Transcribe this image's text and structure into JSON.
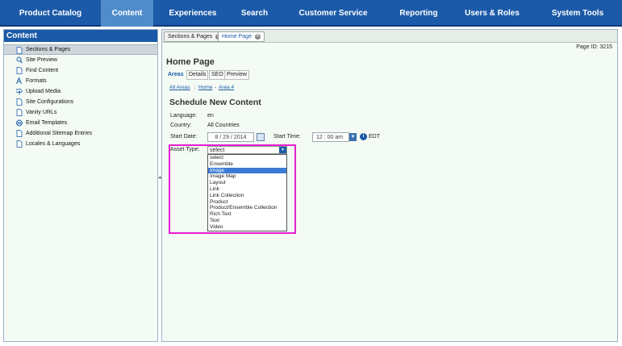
{
  "topnav": [
    {
      "label": "Product Catalog",
      "active": false
    },
    {
      "label": "Content",
      "active": true
    },
    {
      "label": "Experiences",
      "active": false
    },
    {
      "label": "Search",
      "active": false
    },
    {
      "label": "Customer Service",
      "active": false
    },
    {
      "label": "Reporting",
      "active": false
    },
    {
      "label": "Users & Roles",
      "active": false
    },
    {
      "label": "System Tools",
      "active": false
    }
  ],
  "sidebar": {
    "title": "Content",
    "items": [
      {
        "label": "Sections & Pages",
        "icon": "page-icon"
      },
      {
        "label": "Site Preview",
        "icon": "magnifier-icon"
      },
      {
        "label": "Find Content",
        "icon": "page-icon"
      },
      {
        "label": "Formats",
        "icon": "format-icon"
      },
      {
        "label": "Upload Media",
        "icon": "upload-icon"
      },
      {
        "label": "Site Configurations",
        "icon": "page-icon"
      },
      {
        "label": "Vanity URLs",
        "icon": "page-icon"
      },
      {
        "label": "Email Templates",
        "icon": "email-icon"
      },
      {
        "label": "Additional Sitemap Entries",
        "icon": "page-icon"
      },
      {
        "label": "Locales & Languages",
        "icon": "page-icon"
      }
    ]
  },
  "tabs": [
    {
      "label": "Sections & Pages"
    },
    {
      "label": "Home Page"
    }
  ],
  "page_id": "Page ID: 3215",
  "page_title": "Home Page",
  "subtabs": [
    "Areas",
    "Details",
    "SEO",
    "Preview"
  ],
  "breadcrumb": {
    "link1": "All Areas",
    "sep1": ":",
    "link2": "Home",
    "sep2": "-",
    "link3": "Area 4"
  },
  "form": {
    "heading": "Schedule New Content",
    "language_label": "Language:",
    "language_value": "en",
    "country_label": "Country:",
    "country_value": "All Countries",
    "start_date_label": "Start Date:",
    "start_date_value": "8  /  29  /  2014",
    "start_time_label": "Start Time:",
    "start_time_value": "12  :  00    am",
    "timezone": "EDT",
    "asset_type_label": "Asset Type:",
    "asset_type_value": "select",
    "asset_options": [
      "select",
      "Ensemble",
      "Image",
      "Image Map",
      "Layout",
      "Link",
      "Link Collection",
      "Product",
      "Product/Ensemble Collection",
      "Rich Text",
      "Text",
      "Video"
    ],
    "highlighted_option": "Image"
  },
  "colors": {
    "nav_bg": "#1b5aa8",
    "nav_active": "#4f8cc9",
    "highlight_border": "#e61ed2",
    "panel_bg": "#f4fbf4"
  }
}
